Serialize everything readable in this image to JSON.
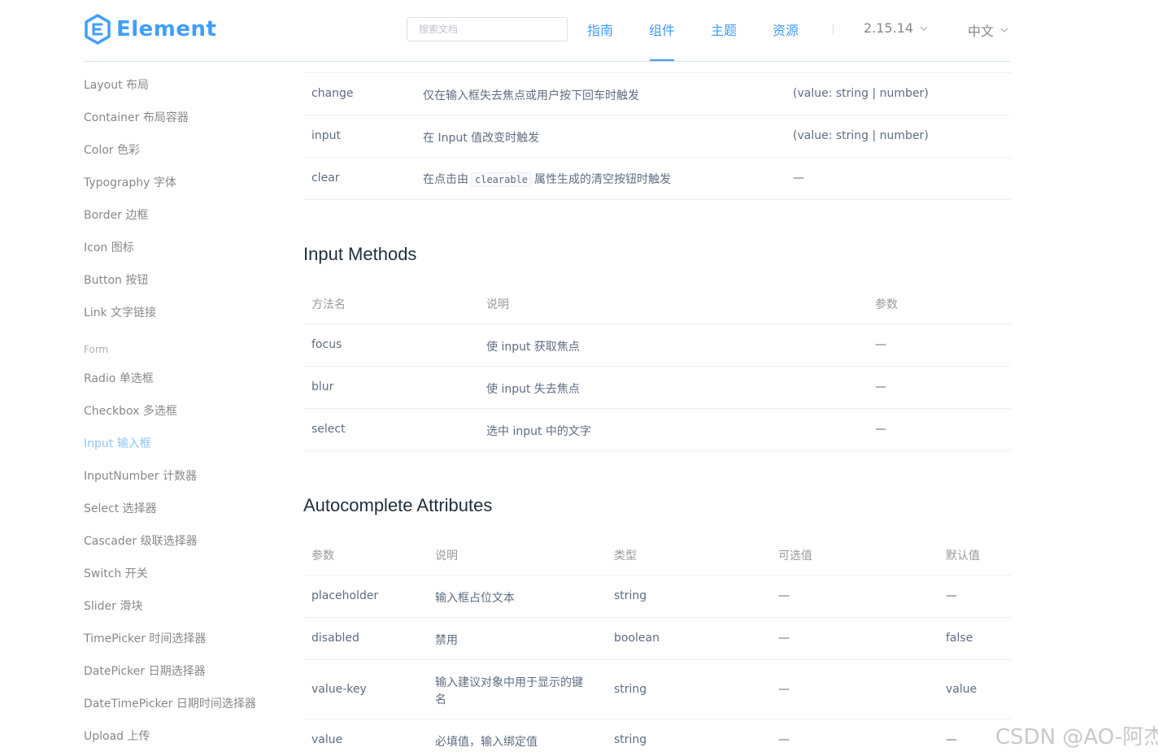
{
  "header": {
    "logo_text": "Element",
    "search_placeholder": "搜索文档",
    "nav": [
      "指南",
      "组件",
      "主题",
      "资源"
    ],
    "version": "2.15.14",
    "language": "中文",
    "colors": {
      "accent": "#409eff",
      "active_sidebar": "#8ec4f6"
    }
  },
  "sidebar": {
    "items_basic": [
      "Layout 布局",
      "Container 布局容器",
      "Color 色彩",
      "Typography 字体",
      "Border 边框",
      "Icon 图标",
      "Button 按钮",
      "Link 文字链接"
    ],
    "group_form": "Form",
    "items_form": [
      "Radio 单选框",
      "Checkbox 多选框",
      "Input 输入框",
      "InputNumber 计数器",
      "Select 选择器",
      "Cascader 级联选择器",
      "Switch 开关",
      "Slider 滑块",
      "TimePicker 时间选择器",
      "DatePicker 日期选择器",
      "DateTimePicker 日期时间选择器",
      "Upload 上传"
    ],
    "active_item": "Input 输入框"
  },
  "events_table": {
    "rows": [
      {
        "name": "change",
        "desc": "仅在输入框失去焦点或用户按下回车时触发",
        "params": "(value: string | number)"
      },
      {
        "name": "input",
        "desc": "在 Input 值改变时触发",
        "params": "(value: string | number)"
      },
      {
        "name": "clear",
        "desc_before": "在点击由",
        "desc_code": "clearable",
        "desc_after": "属性生成的清空按钮时触发",
        "params": "—"
      }
    ]
  },
  "methods": {
    "title": "Input Methods",
    "headers": [
      "方法名",
      "说明",
      "参数"
    ],
    "rows": [
      {
        "name": "focus",
        "desc": "使 input 获取焦点",
        "params": "—"
      },
      {
        "name": "blur",
        "desc": "使 input 失去焦点",
        "params": "—"
      },
      {
        "name": "select",
        "desc": "选中 input 中的文字",
        "params": "—"
      }
    ]
  },
  "autocomplete": {
    "title": "Autocomplete Attributes",
    "headers": [
      "参数",
      "说明",
      "类型",
      "可选值",
      "默认值"
    ],
    "rows": [
      {
        "param": "placeholder",
        "desc": "输入框占位文本",
        "type": "string",
        "options": "—",
        "default": "—"
      },
      {
        "param": "disabled",
        "desc": "禁用",
        "type": "boolean",
        "options": "—",
        "default": "false"
      },
      {
        "param": "value-key",
        "desc_line1": "输入建议对象中用于显示的键",
        "desc_line2": "名",
        "type": "string",
        "options": "—",
        "default": "value"
      },
      {
        "param": "value",
        "desc": "必填值，输入绑定值",
        "type": "string",
        "options": "—",
        "default": "—"
      }
    ]
  },
  "watermark": "CSDN @AO-阿杰"
}
